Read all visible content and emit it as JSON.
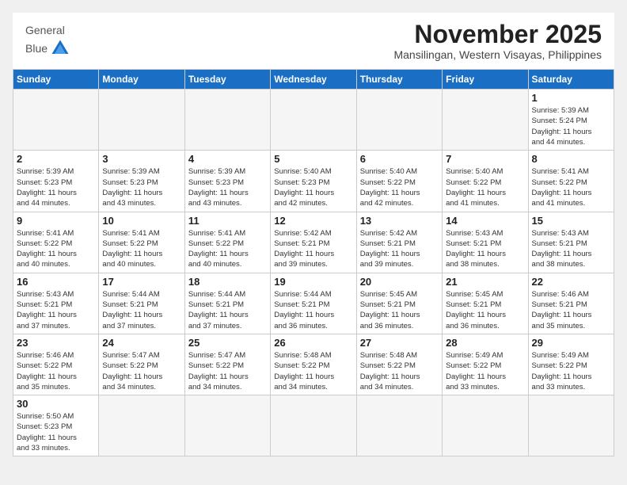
{
  "header": {
    "logo_text_general": "General",
    "logo_text_blue": "Blue",
    "month": "November 2025",
    "location": "Mansilingan, Western Visayas, Philippines"
  },
  "weekdays": [
    "Sunday",
    "Monday",
    "Tuesday",
    "Wednesday",
    "Thursday",
    "Friday",
    "Saturday"
  ],
  "weeks": [
    [
      {
        "day": "",
        "info": ""
      },
      {
        "day": "",
        "info": ""
      },
      {
        "day": "",
        "info": ""
      },
      {
        "day": "",
        "info": ""
      },
      {
        "day": "",
        "info": ""
      },
      {
        "day": "",
        "info": ""
      },
      {
        "day": "1",
        "info": "Sunrise: 5:39 AM\nSunset: 5:24 PM\nDaylight: 11 hours\nand 44 minutes."
      }
    ],
    [
      {
        "day": "2",
        "info": "Sunrise: 5:39 AM\nSunset: 5:23 PM\nDaylight: 11 hours\nand 44 minutes."
      },
      {
        "day": "3",
        "info": "Sunrise: 5:39 AM\nSunset: 5:23 PM\nDaylight: 11 hours\nand 43 minutes."
      },
      {
        "day": "4",
        "info": "Sunrise: 5:39 AM\nSunset: 5:23 PM\nDaylight: 11 hours\nand 43 minutes."
      },
      {
        "day": "5",
        "info": "Sunrise: 5:40 AM\nSunset: 5:23 PM\nDaylight: 11 hours\nand 42 minutes."
      },
      {
        "day": "6",
        "info": "Sunrise: 5:40 AM\nSunset: 5:22 PM\nDaylight: 11 hours\nand 42 minutes."
      },
      {
        "day": "7",
        "info": "Sunrise: 5:40 AM\nSunset: 5:22 PM\nDaylight: 11 hours\nand 41 minutes."
      },
      {
        "day": "8",
        "info": "Sunrise: 5:41 AM\nSunset: 5:22 PM\nDaylight: 11 hours\nand 41 minutes."
      }
    ],
    [
      {
        "day": "9",
        "info": "Sunrise: 5:41 AM\nSunset: 5:22 PM\nDaylight: 11 hours\nand 40 minutes."
      },
      {
        "day": "10",
        "info": "Sunrise: 5:41 AM\nSunset: 5:22 PM\nDaylight: 11 hours\nand 40 minutes."
      },
      {
        "day": "11",
        "info": "Sunrise: 5:41 AM\nSunset: 5:22 PM\nDaylight: 11 hours\nand 40 minutes."
      },
      {
        "day": "12",
        "info": "Sunrise: 5:42 AM\nSunset: 5:21 PM\nDaylight: 11 hours\nand 39 minutes."
      },
      {
        "day": "13",
        "info": "Sunrise: 5:42 AM\nSunset: 5:21 PM\nDaylight: 11 hours\nand 39 minutes."
      },
      {
        "day": "14",
        "info": "Sunrise: 5:43 AM\nSunset: 5:21 PM\nDaylight: 11 hours\nand 38 minutes."
      },
      {
        "day": "15",
        "info": "Sunrise: 5:43 AM\nSunset: 5:21 PM\nDaylight: 11 hours\nand 38 minutes."
      }
    ],
    [
      {
        "day": "16",
        "info": "Sunrise: 5:43 AM\nSunset: 5:21 PM\nDaylight: 11 hours\nand 37 minutes."
      },
      {
        "day": "17",
        "info": "Sunrise: 5:44 AM\nSunset: 5:21 PM\nDaylight: 11 hours\nand 37 minutes."
      },
      {
        "day": "18",
        "info": "Sunrise: 5:44 AM\nSunset: 5:21 PM\nDaylight: 11 hours\nand 37 minutes."
      },
      {
        "day": "19",
        "info": "Sunrise: 5:44 AM\nSunset: 5:21 PM\nDaylight: 11 hours\nand 36 minutes."
      },
      {
        "day": "20",
        "info": "Sunrise: 5:45 AM\nSunset: 5:21 PM\nDaylight: 11 hours\nand 36 minutes."
      },
      {
        "day": "21",
        "info": "Sunrise: 5:45 AM\nSunset: 5:21 PM\nDaylight: 11 hours\nand 36 minutes."
      },
      {
        "day": "22",
        "info": "Sunrise: 5:46 AM\nSunset: 5:21 PM\nDaylight: 11 hours\nand 35 minutes."
      }
    ],
    [
      {
        "day": "23",
        "info": "Sunrise: 5:46 AM\nSunset: 5:22 PM\nDaylight: 11 hours\nand 35 minutes."
      },
      {
        "day": "24",
        "info": "Sunrise: 5:47 AM\nSunset: 5:22 PM\nDaylight: 11 hours\nand 34 minutes."
      },
      {
        "day": "25",
        "info": "Sunrise: 5:47 AM\nSunset: 5:22 PM\nDaylight: 11 hours\nand 34 minutes."
      },
      {
        "day": "26",
        "info": "Sunrise: 5:48 AM\nSunset: 5:22 PM\nDaylight: 11 hours\nand 34 minutes."
      },
      {
        "day": "27",
        "info": "Sunrise: 5:48 AM\nSunset: 5:22 PM\nDaylight: 11 hours\nand 34 minutes."
      },
      {
        "day": "28",
        "info": "Sunrise: 5:49 AM\nSunset: 5:22 PM\nDaylight: 11 hours\nand 33 minutes."
      },
      {
        "day": "29",
        "info": "Sunrise: 5:49 AM\nSunset: 5:22 PM\nDaylight: 11 hours\nand 33 minutes."
      }
    ],
    [
      {
        "day": "30",
        "info": "Sunrise: 5:50 AM\nSunset: 5:23 PM\nDaylight: 11 hours\nand 33 minutes."
      },
      {
        "day": "",
        "info": ""
      },
      {
        "day": "",
        "info": ""
      },
      {
        "day": "",
        "info": ""
      },
      {
        "day": "",
        "info": ""
      },
      {
        "day": "",
        "info": ""
      },
      {
        "day": "",
        "info": ""
      }
    ]
  ]
}
